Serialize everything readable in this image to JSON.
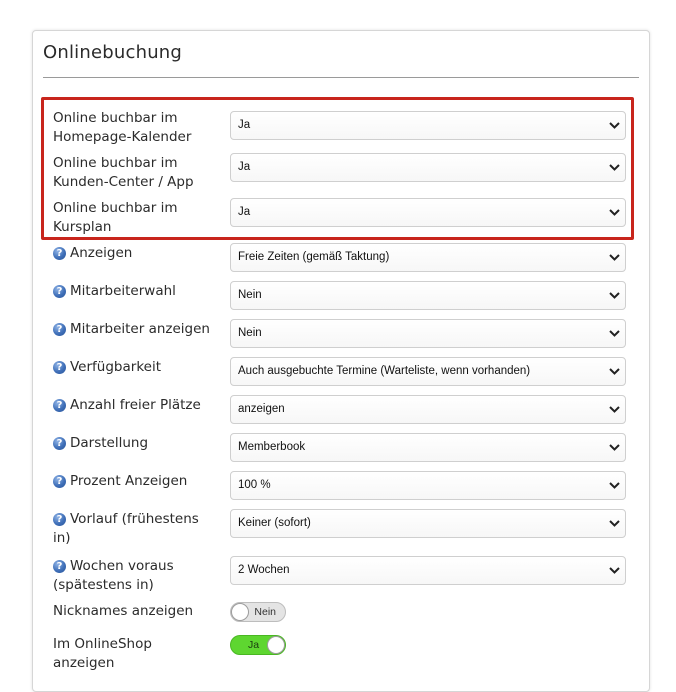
{
  "section": {
    "title": "Onlinebuchung"
  },
  "fields": [
    {
      "label": "Online buchbar im Homepage-Kalender",
      "value": "Ja",
      "help": false
    },
    {
      "label": "Online buchbar im Kunden-Center / App",
      "value": "Ja",
      "help": false
    },
    {
      "label": "Online buchbar im Kursplan",
      "value": "Ja",
      "help": false
    },
    {
      "label": "Anzeigen",
      "value": "Freie Zeiten (gemäß Taktung)",
      "help": true
    },
    {
      "label": "Mitarbeiterwahl",
      "value": "Nein",
      "help": true
    },
    {
      "label": "Mitarbeiter anzeigen",
      "value": "Nein",
      "help": true
    },
    {
      "label": "Verfügbarkeit",
      "value": "Auch ausgebuchte Termine (Warteliste, wenn vorhanden)",
      "help": true
    },
    {
      "label": "Anzahl freier Plätze",
      "value": "anzeigen",
      "help": true
    },
    {
      "label": "Darstellung",
      "value": "Memberbook",
      "help": true
    },
    {
      "label": "Prozent Anzeigen",
      "value": "100 %",
      "help": true
    },
    {
      "label": "Vorlauf (frühestens in)",
      "value": "Keiner (sofort)",
      "help": true
    },
    {
      "label": "Wochen voraus (spätestens in)",
      "value": "2 Wochen",
      "help": true
    }
  ],
  "toggles": [
    {
      "label": "Nicknames anzeigen",
      "state_label": "Nein",
      "on": false
    },
    {
      "label": "Im OnlineShop anzeigen",
      "state_label": "Ja",
      "on": true
    }
  ],
  "icons": {
    "help": "help-question-icon",
    "dropdown": "chevron-down-icon"
  },
  "colors": {
    "highlight_border": "#c8251c",
    "toggle_on": "#5ed630",
    "toggle_off": "#e4e4e4",
    "help_icon": "#3f6fb8"
  }
}
